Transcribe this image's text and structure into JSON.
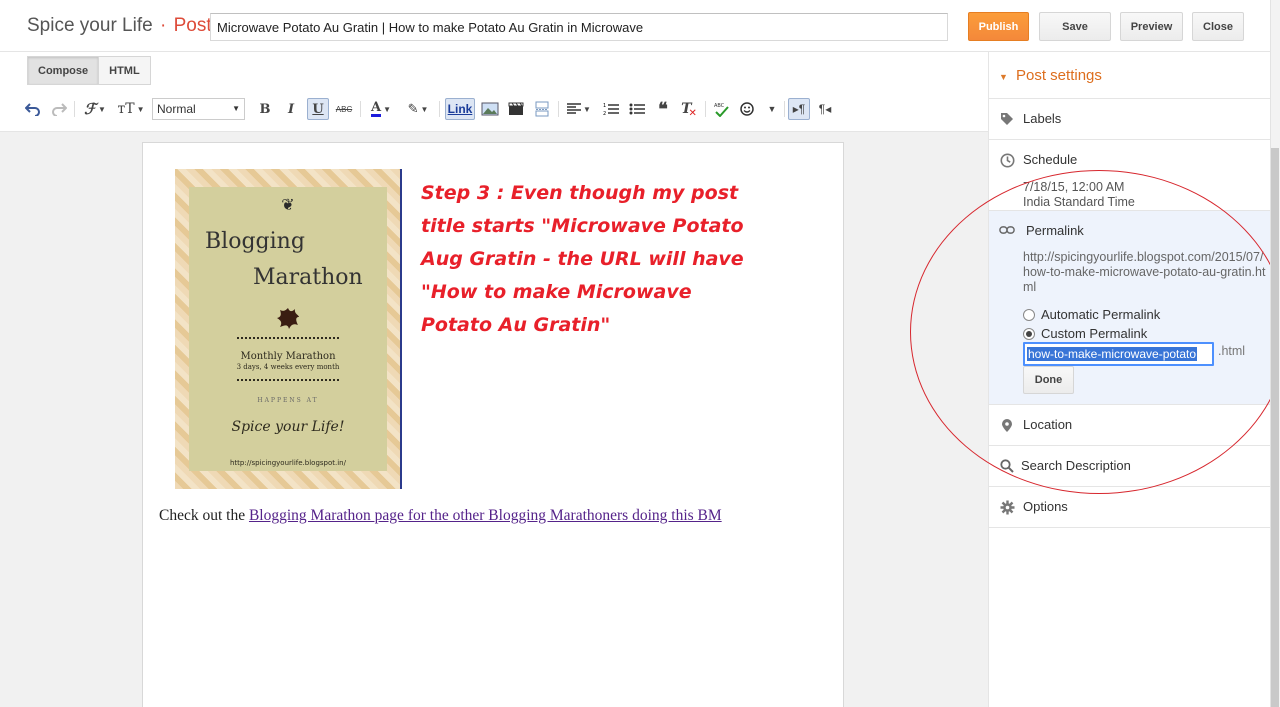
{
  "header": {
    "blog_name": "Spice your Life",
    "separator": "·",
    "post_label": "Post",
    "post_title": "Microwave Potato Au Gratin | How to make Potato Au Gratin in Microwave",
    "buttons": {
      "publish": "Publish",
      "save": "Save",
      "preview": "Preview",
      "close": "Close"
    }
  },
  "editor": {
    "mode_tabs": [
      "Compose",
      "HTML"
    ],
    "active_mode": "Compose",
    "format_select": "Normal",
    "link_button": "Link",
    "toolbar_icons": [
      "undo-icon",
      "redo-icon",
      "font-family-icon",
      "font-size-icon",
      "bold-icon",
      "italic-icon",
      "underline-icon",
      "strikethrough-icon",
      "text-color-icon",
      "highlight-icon",
      "link-icon",
      "image-icon",
      "video-icon",
      "jump-break-icon",
      "align-icon",
      "numbered-list-icon",
      "bulleted-list-icon",
      "quote-icon",
      "remove-format-icon",
      "spellcheck-icon",
      "emoji-icon",
      "more-icon",
      "ltr-icon",
      "rtl-icon"
    ],
    "bold": "B",
    "italic": "I",
    "underline": "U",
    "strike": "ABC"
  },
  "content": {
    "poster": {
      "title1": "Blogging",
      "title2": "Marathon",
      "monthly": "Monthly Marathon",
      "days": "3 days, 4 weeks every month",
      "happens": "HAPPENS AT",
      "spice": "Spice your Life!",
      "url": "http://spicingyourlife.blogspot.in/"
    },
    "step_note": "Step 3 : Even though my post title starts \"Microwave Potato Aug Gratin - the URL will have \"How to make Microwave Potato Au Gratin\"",
    "checkout_prefix": "Check out the ",
    "checkout_link": "Blogging Marathon page for the other Blogging Marathoners doing this BM"
  },
  "sidebar": {
    "header": "Post settings",
    "labels": "Labels",
    "schedule": "Schedule",
    "schedule_datetime": "7/18/15, 12:00 AM",
    "schedule_tz": "India Standard Time",
    "permalink": "Permalink",
    "permalink_url": "http://spicingyourlife.blogspot.com/2015/07/how-to-make-microwave-potato-au-gratin.html",
    "automatic_permalink": "Automatic Permalink",
    "custom_permalink": "Custom Permalink",
    "custom_value": "how-to-make-microwave-potato",
    "html_suffix": ".html",
    "done": "Done",
    "location": "Location",
    "search_description": "Search Description",
    "options": "Options"
  },
  "colors": {
    "accent_orange": "#dd6e1e",
    "publish_orange": "#f4883a",
    "annotation_red": "#e8202a",
    "link_purple": "#55238a",
    "selection_blue": "#3875d7"
  }
}
